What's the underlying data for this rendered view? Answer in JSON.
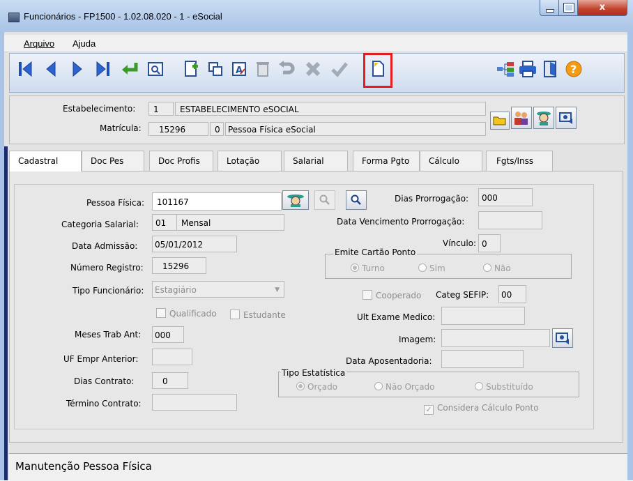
{
  "window": {
    "title": "Funcionários - FP1500 - 1.02.08.020 - 1 - eSocial",
    "close_glyph": "x"
  },
  "menu": {
    "items": [
      {
        "label": "Arquivo"
      },
      {
        "label": "Ajuda"
      }
    ]
  },
  "toolbar": {
    "icons": [
      "first-record-icon",
      "previous-record-icon",
      "next-record-icon",
      "last-record-icon",
      "enter-icon",
      "zoom-icon",
      "new-page-icon",
      "copy-icon",
      "edit-text-icon",
      "delete-icon",
      "undo-icon",
      "cancel-icon",
      "confirm-icon",
      "new-document-icon",
      "tree-icon",
      "print-icon",
      "exit-door-icon",
      "help-icon"
    ],
    "help_glyph": "?",
    "highlight_color": "#e31d1d"
  },
  "header": {
    "estabelecimento_label": "Estabelecimento:",
    "estabelecimento_code": "1",
    "estabelecimento_name": "ESTABELECIMENTO eSOCIAL",
    "matricula_label": "Matrícula:",
    "matricula_value": "15296",
    "matricula_digit": "0",
    "matricula_name": "Pessoa Física eSocial"
  },
  "tabs": [
    {
      "label": "Cadastral",
      "active": true
    },
    {
      "label": "Doc Pes"
    },
    {
      "label": "Doc Profis"
    },
    {
      "label": "Lotação"
    },
    {
      "label": "Salarial"
    },
    {
      "label": "Forma Pgto"
    },
    {
      "label": "Cálculo"
    },
    {
      "label": "Fgts/Inss"
    }
  ],
  "form": {
    "pessoa_fisica_label": "Pessoa Física:",
    "pessoa_fisica_value": "101167",
    "dias_prorrogacao_label": "Dias Prorrogação:",
    "dias_prorrogacao_value": "000",
    "categoria_salarial_label": "Categoria Salarial:",
    "categoria_salarial_code": "01",
    "categoria_salarial_name": "Mensal",
    "data_vencimento_label": "Data Vencimento Prorrogação:",
    "data_vencimento_value": "",
    "data_admissao_label": "Data Admissão:",
    "data_admissao_value": "05/01/2012",
    "vinculo_label": "Vínculo:",
    "vinculo_value": "0",
    "emite_cartao_label": "Emite Cartão Ponto",
    "emite_options": [
      "Turno",
      "Sim",
      "Não"
    ],
    "numero_registro_label": "Número Registro:",
    "numero_registro_value": "15296",
    "tipo_funcionario_label": "Tipo Funcionário:",
    "tipo_funcionario_value": "Estagiário",
    "cooperado_label": "Cooperado",
    "categ_sefip_label": "Categ SEFIP:",
    "categ_sefip_value": "00",
    "qualificado_label": "Qualificado",
    "estudante_label": "Estudante",
    "ult_exame_label": "Ult Exame Medico:",
    "meses_trab_label": "Meses Trab Ant:",
    "meses_trab_value": "000",
    "imagem_label": "Imagem:",
    "uf_empr_label": "UF Empr Anterior:",
    "data_aposentadoria_label": "Data Aposentadoria:",
    "dias_contrato_label": "Dias Contrato:",
    "dias_contrato_value": "0",
    "tipo_estatistica_label": "Tipo Estatística",
    "estatistica_options": [
      "Orçado",
      "Não Orçado",
      "Substituído"
    ],
    "termino_contrato_label": "Término Contrato:",
    "considera_label": "Considera Cálculo Ponto"
  },
  "status": {
    "text": "Manutenção Pessoa Física"
  }
}
